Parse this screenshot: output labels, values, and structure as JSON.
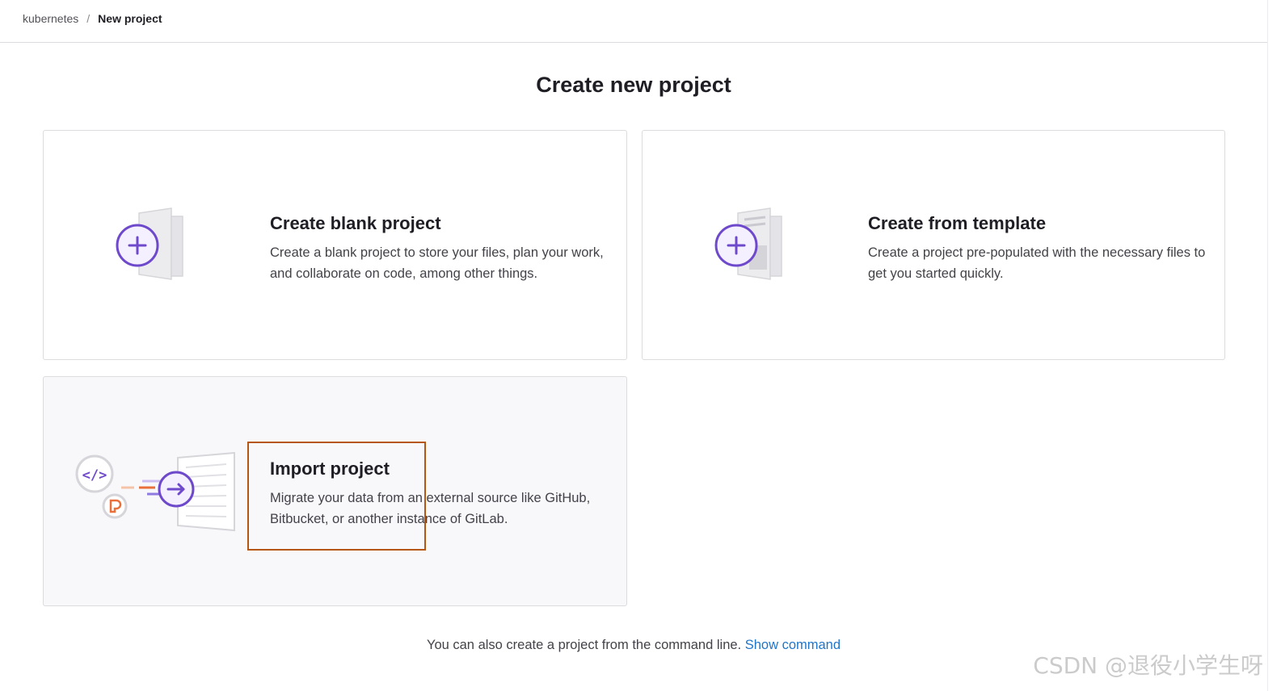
{
  "breadcrumb": {
    "group": "kubernetes",
    "separator": "/",
    "current": "New project"
  },
  "page": {
    "title": "Create new project"
  },
  "cards": {
    "blank": {
      "title": "Create blank project",
      "description": "Create a blank project to store your files, plan your work, and collaborate on code, among other things.",
      "icon": "blank-project-illustration"
    },
    "template": {
      "title": "Create from template",
      "description": "Create a project pre-populated with the necessary files to get you started quickly.",
      "icon": "template-project-illustration"
    },
    "import": {
      "title": "Import project",
      "description": "Migrate your data from an external source like GitHub, Bitbucket, or another instance of GitLab.",
      "icon": "import-project-illustration"
    }
  },
  "footer": {
    "text": "You can also create a project from the command line.",
    "link_label": "Show command"
  },
  "watermark": "CSDN @退役小学生呀",
  "colors": {
    "accent_purple": "#6e49cb",
    "link_blue": "#1f75cb",
    "highlight_box": "#b5570e",
    "orange": "#e9703b"
  }
}
